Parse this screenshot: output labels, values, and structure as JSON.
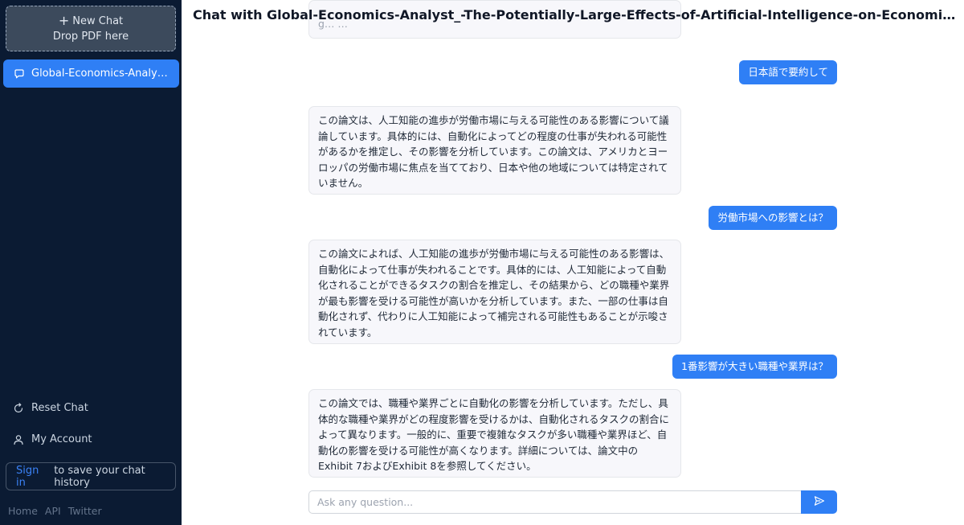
{
  "sidebar": {
    "new_chat": {
      "label": "New Chat",
      "drop_text": "Drop PDF here"
    },
    "chats": [
      {
        "label": "Global-Economics-Analyst_-The-Potentially-Large-Effects-of-Artificial-Intelligence-on-Economic-Growth-Briggs_Kodnani"
      }
    ],
    "reset_label": "Reset Chat",
    "account_label": "My Account",
    "signin": {
      "link": "Sign in",
      "text": "to save your chat history"
    },
    "footer": [
      "Home",
      "API",
      "Twitter"
    ]
  },
  "main": {
    "title": "Chat with Global-Economics-Analyst_-The-Potentially-Large-Effects-of-Artificial-Intelligence-on-Economic-Growth-Briggs_Kodnani",
    "messages": [
      {
        "role": "assistant",
        "text": "g… …"
      },
      {
        "role": "user",
        "text": "日本語で要約して"
      },
      {
        "role": "assistant",
        "text": "この論文は、人工知能の進歩が労働市場に与える可能性のある影響について議論しています。具体的には、自動化によってどの程度の仕事が失われる可能性があるかを推定し、その影響を分析しています。この論文は、アメリカとヨーロッパの労働市場に焦点を当てており、日本や他の地域については特定されていません。"
      },
      {
        "role": "user",
        "text": "労働市場への影響とは？"
      },
      {
        "role": "assistant",
        "text": "この論文によれば、人工知能の進歩が労働市場に与える可能性のある影響は、自動化によって仕事が失われることです。具体的には、人工知能によって自動化されることができるタスクの割合を推定し、その結果から、どの職種や業界が最も影響を受ける可能性が高いかを分析しています。また、一部の仕事は自動化されず、代わりに人工知能によって補完される可能性もあることが示唆されています。"
      },
      {
        "role": "user",
        "text": "1番影響が大きい職種や業界は？"
      },
      {
        "role": "assistant",
        "text": "この論文では、職種や業界ごとに自動化の影響を分析しています。ただし、具体的な職種や業界がどの程度影響を受けるかは、自動化されるタスクの割合によって異なります。一般的に、重要で複雑なタスクが多い職種や業界ほど、自動化の影響を受ける可能性が高くなります。詳細については、論文中のExhibit 7およびExhibit 8を参照してください。"
      }
    ],
    "input": {
      "placeholder": "Ask any question...",
      "value": ""
    }
  },
  "colors": {
    "sidebar_bg": "#0b1b33",
    "accent": "#2f7ff5",
    "ai_bubble": "#f7f7fb"
  },
  "icons": [
    "plus-icon",
    "chat-bubble-icon",
    "reset-icon",
    "user-icon",
    "send-icon"
  ]
}
